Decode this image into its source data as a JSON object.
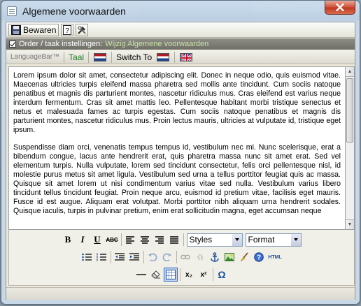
{
  "window": {
    "title": "Algemene voorwaarden"
  },
  "toolbar": {
    "save_label": "Bewaren"
  },
  "order_bar": {
    "label": "Order / taak instellingen:",
    "sublabel": "Wijzig Algemene voorwaarden"
  },
  "language_bar": {
    "label": "LanguageBar™",
    "taal_label": "Taal",
    "switch_label": "Switch To"
  },
  "editor": {
    "paragraphs": [
      "Lorem ipsum dolor sit amet, consectetur adipiscing elit. Donec in neque odio, quis euismod vitae. Maecenas ultricies turpis eleifend massa pharetra sed mollis ante tincidunt. Cum sociis natoque penatibus et magnis dis parturient montes, nascetur ridiculus mus. Cras eleifend est varius neque interdum fermentum. Cras sit amet mattis leo. Pellentesque habitant morbi tristique senectus et netus et malesuada fames ac turpis egestas. Cum sociis natoque penatibus et magnis dis parturient montes, nascetur ridiculus mus. Proin lectus mauris, ultricies at vulputate id, tristique eget ipsum.",
      "Suspendisse diam orci, venenatis tempus tempus id, vestibulum nec mi. Nunc scelerisque, erat a bibendum congue, lacus ante hendrerit erat, quis pharetra massa nunc sit amet erat. Sed vel elementum turpis. Nulla vulputate, lorem sed tincidunt consectetur, felis orci pellentesque nisl, id molestie purus metus sit amet ligula. Vestibulum sed urna a tellus porttitor feugiat quis ac massa. Quisque sit amet lorem ut nisi condimentum varius vitae sed nulla. Vestibulum varius libero tincidunt tellus tincidunt feugiat. Proin neque arcu, euismod id pretium vitae, facilisis eget mauris. Fusce id est augue. Aliquam erat volutpat. Morbi porttitor nibh aliquam urna hendrerit sodales. Quisque iaculis, turpis in pulvinar pretium, enim erat sollicitudin magna, eget accumsan neque"
    ]
  },
  "format_toolbar": {
    "bold": "B",
    "italic": "I",
    "underline": "U",
    "strike": "ABC",
    "styles": "Styles",
    "format": "Format",
    "html": "HTML",
    "subscript": "x₂",
    "superscript": "x²",
    "omega": "Ω"
  },
  "colors": {
    "accent": "#316ac5",
    "taal_green": "#2a7a2a",
    "order_bar": "#7d7d75",
    "close_red": "#c0391f"
  }
}
